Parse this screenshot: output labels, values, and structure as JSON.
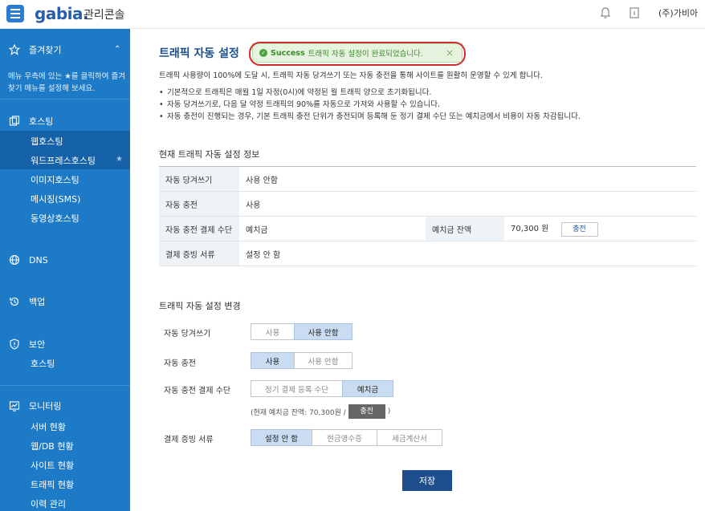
{
  "header": {
    "logo": "gabia.",
    "logo_sub": "관리콘솔",
    "company": "(주)가비아"
  },
  "sidebar": {
    "favorites": {
      "label": "즐겨찾기",
      "desc": "메뉴 우측에 있는 ★를 클릭하여 즐겨찾기 메뉴를 설정해 보세요."
    },
    "hosting": {
      "label": "호스팅",
      "items": [
        "웹호스팅",
        "워드프레스호스팅",
        "이미지호스팅",
        "메시징(SMS)",
        "동영상호스팅"
      ]
    },
    "dns": {
      "label": "DNS"
    },
    "backup": {
      "label": "백업"
    },
    "security": {
      "label": "보안",
      "items": [
        "호스팅"
      ]
    },
    "monitoring": {
      "label": "모니터링",
      "items": [
        "서버 현황",
        "웹/DB 현황",
        "사이트 현황",
        "트래픽 현황",
        "이력 관리"
      ]
    }
  },
  "main": {
    "title": "트래픽 자동 설정",
    "toast": {
      "strong": "Success",
      "text": "트래픽 자동 설정이 완료되었습니다.",
      "close": "×"
    },
    "desc": "트래픽 사용량이 100%에 도달 시, 트래픽 자동 당겨쓰기 또는 자동 충전을 통해 사이트를 원활히 운영할 수 있게 합니다.",
    "bullets": [
      "기본적으로 트래픽은 매월 1일 자정(0시)에 약정된 월 트래픽 양으로 초기화됩니다.",
      "자동 당겨쓰기로, 다음 달 약정 트래픽의 90%를 자동으로 가져와 사용할 수 있습니다.",
      "자동 충전이 진행되는 경우, 기본 트래픽 충전 단위가 충전되며 등록해 둔 정기 결제 수단 또는 예치금에서 비용이 자동 차감됩니다."
    ],
    "info_title": "현재 트래픽 자동 설정 정보",
    "info": {
      "pull_label": "자동 당겨쓰기",
      "pull_value": "사용 안함",
      "charge_label": "자동 충전",
      "charge_value": "사용",
      "method_label": "자동 충전 결제 수단",
      "method_value": "예치금",
      "balance_label": "예치금 잔액",
      "balance_value": "70,300 원",
      "charge_btn": "충전",
      "receipt_label": "결제 증빙 서류",
      "receipt_value": "설정 안 함"
    },
    "change_title": "트래픽 자동 설정 변경",
    "form": {
      "pull_label": "자동 당겨쓰기",
      "pull_opts": [
        "사용",
        "사용 안함"
      ],
      "charge_label": "자동 충전",
      "charge_opts": [
        "사용",
        "사용 안함"
      ],
      "method_label": "자동 충전 결제 수단",
      "method_opts": [
        "정기 결제 등록 수단",
        "예치금"
      ],
      "balance_note_pre": "(현재 예치금 잔액: 70,300원 /",
      "balance_btn": "충전",
      "balance_note_post": ")",
      "receipt_label": "결제 증빙 서류",
      "receipt_opts": [
        "설정 안 함",
        "현금영수증",
        "세금계산서"
      ]
    },
    "save": "저장"
  }
}
